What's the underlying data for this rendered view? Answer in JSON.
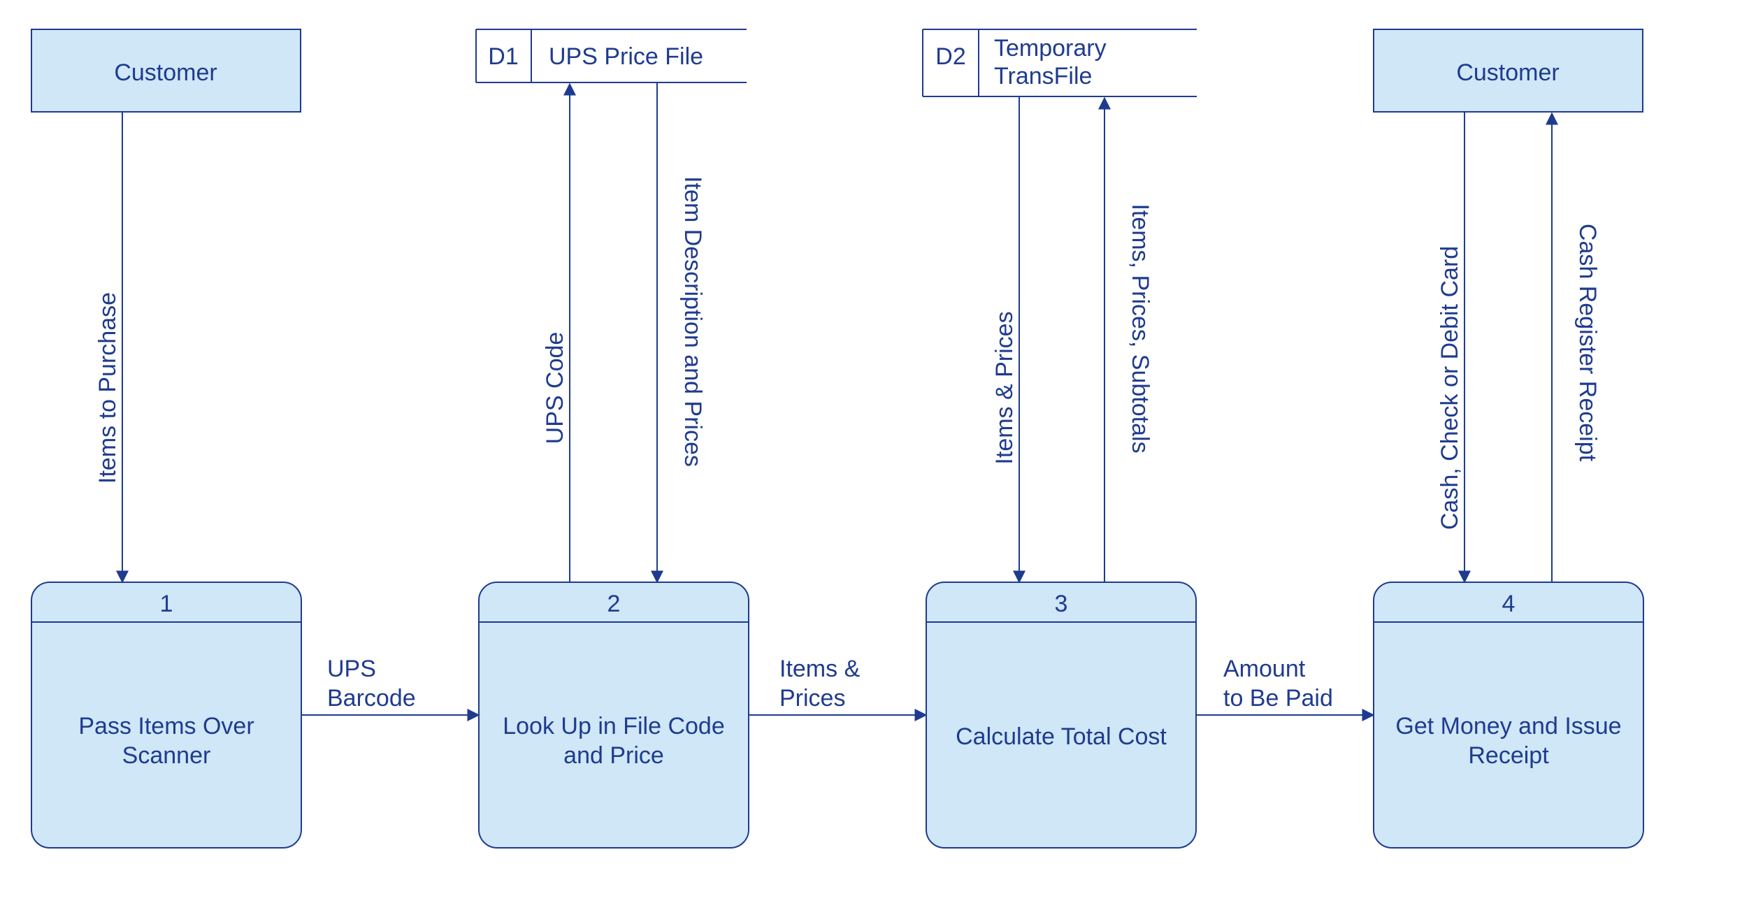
{
  "entities": {
    "customer_left": "Customer",
    "customer_right": "Customer"
  },
  "datastores": {
    "d1": {
      "id": "D1",
      "name": "UPS Price File"
    },
    "d2": {
      "id": "D2",
      "name_line1": "Temporary",
      "name_line2": "TransFile"
    }
  },
  "processes": {
    "p1": {
      "num": "1",
      "line1": "Pass Items Over",
      "line2": "Scanner"
    },
    "p2": {
      "num": "2",
      "line1": "Look Up in File Code",
      "line2": "and Price"
    },
    "p3": {
      "num": "3",
      "line1": "Calculate Total Cost",
      "line2": ""
    },
    "p4": {
      "num": "4",
      "line1": "Get Money and Issue",
      "line2": "Receipt"
    }
  },
  "flows": {
    "items_to_purchase": "Items to Purchase",
    "ups_barcode_l1": "UPS",
    "ups_barcode_l2": "Barcode",
    "ups_code": "UPS Code",
    "item_desc_prices": "Item Description and Prices",
    "items_prices_l1": "Items &",
    "items_prices_l2": "Prices",
    "items_prices_v": "Items & Prices",
    "items_prices_subtotals": "Items, Prices, Subtotals",
    "amount_l1": "Amount",
    "amount_l2": "to Be Paid",
    "cash_check_debit": "Cash, Check or Debit Card",
    "cash_register_receipt": "Cash Register Receipt"
  }
}
